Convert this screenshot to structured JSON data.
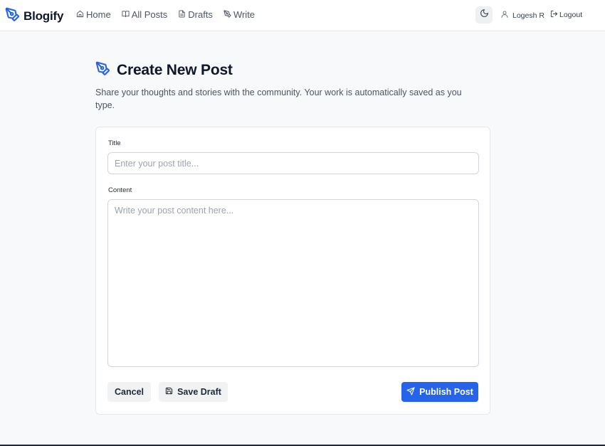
{
  "brand": {
    "name": "Blogify"
  },
  "nav": {
    "items": [
      {
        "label": "Home"
      },
      {
        "label": "All Posts"
      },
      {
        "label": "Drafts"
      },
      {
        "label": "Write"
      }
    ]
  },
  "user": {
    "name": "Logesh R",
    "logout_label": "Logout"
  },
  "page": {
    "title": "Create New Post",
    "subtitle": "Share your thoughts and stories with the community. Your work is automatically saved as you type."
  },
  "form": {
    "title_label": "Title",
    "title_value": "",
    "title_placeholder": "Enter your post title...",
    "content_label": "Content",
    "content_value": "",
    "content_placeholder": "Write your post content here...",
    "cancel_label": "Cancel",
    "save_draft_label": "Save Draft",
    "publish_label": "Publish Post"
  },
  "colors": {
    "accent": "#2563eb",
    "background": "#f8f9fb",
    "heading": "#0f172a"
  },
  "icons": [
    "pen-tool-icon",
    "home-icon",
    "book-icon",
    "file-icon",
    "pen-icon",
    "moon-icon",
    "user-icon",
    "logout-icon",
    "save-icon",
    "send-icon"
  ]
}
